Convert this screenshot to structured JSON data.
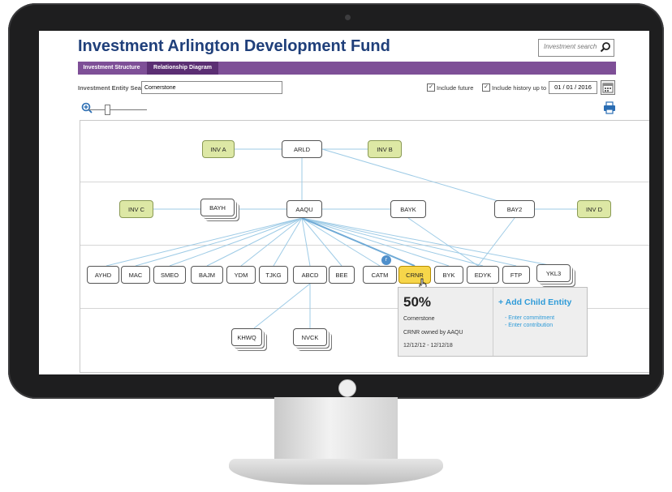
{
  "header": {
    "title": "Investment Arlington Development Fund",
    "search_placeholder": "Investment search"
  },
  "tabs": [
    {
      "label": "Investment Structure"
    },
    {
      "label": "Relationship Diagram"
    }
  ],
  "filters": {
    "entity_search_label": "Investment Entity Search",
    "entity_search_value": "Cornerstone",
    "include_future_label": "Include future",
    "include_future_checked": true,
    "include_history_label": "Include history up to",
    "include_history_checked": true,
    "date_value": "01 / 01 / 2016"
  },
  "diagram": {
    "nodes": {
      "inva": "INV A",
      "arld": "ARLD",
      "invb": "INV B",
      "invc": "INV C",
      "bayh": "BAYH",
      "aaqu": "AAQU",
      "bayk": "BAYK",
      "bay2": "BAY2",
      "invd": "INV D",
      "ayhd": "AYHD",
      "mac": "MAC",
      "smeo": "SMEO",
      "bajm": "BAJM",
      "ydm": "YDM",
      "tjkg": "TJKG",
      "abcd": "ABCD",
      "bee": "BEE",
      "catm": "CATM",
      "crnr": "CRNR",
      "byk": "BYK",
      "edyk": "EDYK",
      "ftp": "FTP",
      "ykl3": "YKL3",
      "khwq": "KHWQ",
      "nvck": "NVCK"
    },
    "popup": {
      "percent": "50%",
      "entity": "Cornerstone",
      "ownership": "CRNR owned by AAQU",
      "date_range": "12/12/12 - 12/12/18",
      "add_label": "+ Add Child Entity",
      "actions": [
        "- Enter commitment",
        "- Enter contribution"
      ]
    }
  },
  "colors": {
    "title": "#1f3f7a",
    "tab_bar": "#7e4f97",
    "tab_active": "#5b2e73",
    "node_green": "#dde8a5",
    "node_selected": "#f7d64a",
    "link": "#9ecbe6",
    "action_blue": "#2f9bd8"
  },
  "icons": [
    "search-icon",
    "zoom-in-icon",
    "calendar-icon",
    "print-icon",
    "pointer-hand-icon",
    "camera-icon"
  ]
}
